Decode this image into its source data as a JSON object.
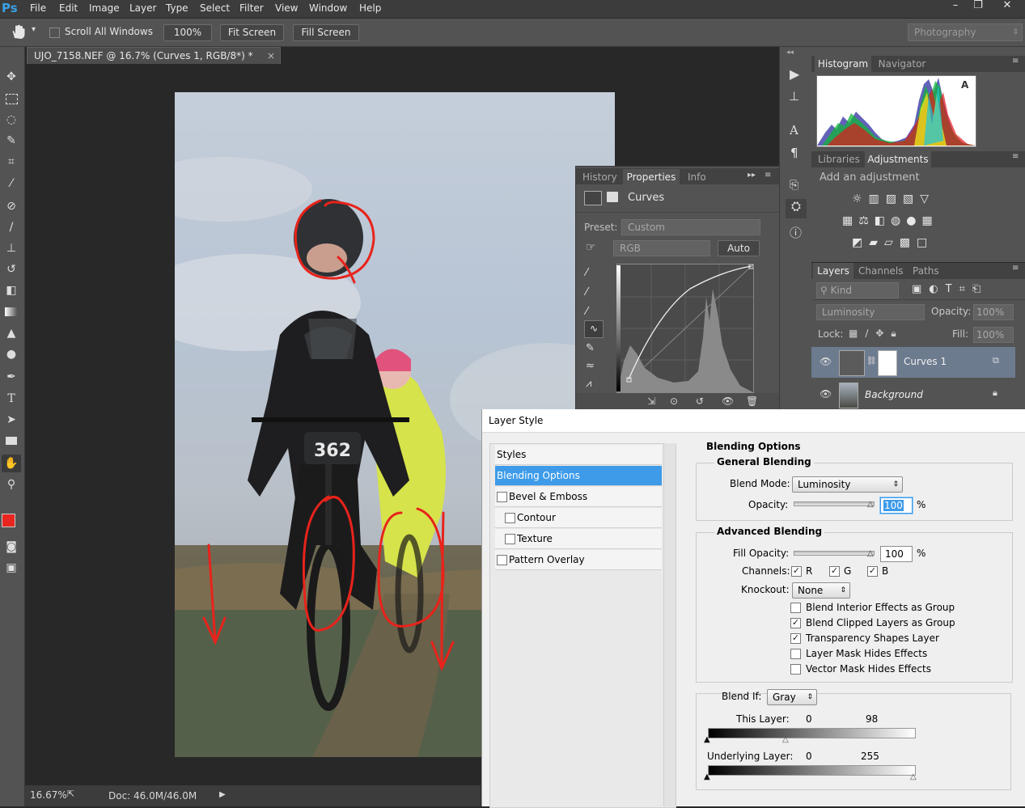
{
  "app": {
    "logo": "Ps"
  },
  "menu": [
    "File",
    "Edit",
    "Image",
    "Layer",
    "Type",
    "Select",
    "Filter",
    "View",
    "Window",
    "Help"
  ],
  "window_controls": {
    "minimize": "–",
    "restore": "❐",
    "close": "✕"
  },
  "options_bar": {
    "scroll_all_windows": "Scroll All Windows",
    "zoom_100": "100%",
    "fit_screen": "Fit Screen",
    "fill_screen": "Fill Screen",
    "workspace": "Photography"
  },
  "document": {
    "tab_title": "UJO_7158.NEF @ 16.7% (Curves 1, RGB/8*) *",
    "tab_close": "×",
    "zoom": "16.67%",
    "doc_size": "Doc: 46.0M/46.0M",
    "race_number": "362"
  },
  "histogram_panel": {
    "tabs": [
      "Histogram",
      "Navigator"
    ],
    "warning": "A"
  },
  "adjustments_panel": {
    "tabs": [
      "Libraries",
      "Adjustments"
    ],
    "heading": "Add an adjustment"
  },
  "properties_panel": {
    "tabs": [
      "History",
      "Properties",
      "Info"
    ],
    "title": "Curves",
    "preset_label": "Preset:",
    "preset_value": "Custom",
    "channel": "RGB",
    "auto": "Auto"
  },
  "layers_panel": {
    "tabs": [
      "Layers",
      "Channels",
      "Paths"
    ],
    "kind": "Kind",
    "blend_mode": "Luminosity",
    "opacity_label": "Opacity:",
    "opacity_value": "100%",
    "lock_label": "Lock:",
    "fill_label": "Fill:",
    "fill_value": "100%",
    "layers": [
      {
        "name": "Curves 1"
      },
      {
        "name": "Background"
      }
    ]
  },
  "layer_style": {
    "title": "Layer Style",
    "styles_list": [
      "Styles",
      "Blending Options",
      "Bevel & Emboss",
      "Contour",
      "Texture",
      "Pattern Overlay"
    ],
    "blending_options_title": "Blending Options",
    "general_blending": "General Blending",
    "blend_mode_label": "Blend Mode:",
    "blend_mode_value": "Luminosity",
    "opacity_label": "Opacity:",
    "opacity_value": "100",
    "percent": "%",
    "advanced_blending": "Advanced Blending",
    "fill_opacity_label": "Fill Opacity:",
    "fill_opacity_value": "100",
    "channels_label": "Channels:",
    "channels": [
      "R",
      "G",
      "B"
    ],
    "knockout_label": "Knockout:",
    "knockout_value": "None",
    "options": [
      {
        "label": "Blend Interior Effects as Group",
        "checked": false
      },
      {
        "label": "Blend Clipped Layers as Group",
        "checked": true
      },
      {
        "label": "Transparency Shapes Layer",
        "checked": true
      },
      {
        "label": "Layer Mask Hides Effects",
        "checked": false
      },
      {
        "label": "Vector Mask Hides Effects",
        "checked": false
      }
    ],
    "blend_if_label": "Blend If:",
    "blend_if_value": "Gray",
    "this_layer_label": "This Layer:",
    "this_layer_min": "0",
    "this_layer_max": "98",
    "underlying_label": "Underlying Layer:",
    "underlying_min": "0",
    "underlying_max": "255"
  },
  "colors": {
    "foreground": "#e8251e",
    "background": "#e8b4a8",
    "accent": "#3d9be9"
  }
}
